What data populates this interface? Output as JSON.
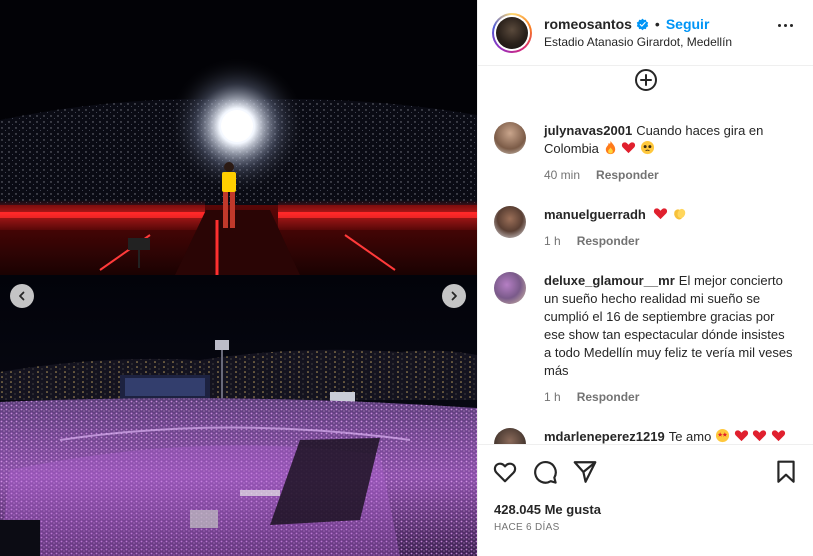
{
  "header": {
    "username": "romeosantos",
    "follow_label": "Seguir",
    "location": "Estadio Atanasio Girardot, Medellín",
    "separator": "•"
  },
  "comments": [
    {
      "user": "julynavas2001",
      "text": "Cuando haces gira en Colombia",
      "emojis": [
        "fire",
        "red-heart",
        "pleading-face"
      ],
      "time": "40 min",
      "reply_label": "Responder"
    },
    {
      "user": "manuelguerradh",
      "text": "",
      "emojis": [
        "red-heart",
        "clapping-hands"
      ],
      "time": "1 h",
      "reply_label": "Responder"
    },
    {
      "user": "deluxe_glamour__mr",
      "text": "El mejor concierto un sueño hecho realidad mi sueño se cumplió el 16 de septiembre gracias por ese show tan espectacular dónde insistes a todo Medellín muy feliz te vería mil veses más",
      "emojis": [],
      "time": "1 h",
      "reply_label": "Responder"
    },
    {
      "user": "mdarleneperez1219",
      "text": "Te amo",
      "emojis": [
        "star-struck",
        "red-heart",
        "red-heart",
        "red-heart"
      ],
      "time": "",
      "reply_label": ""
    }
  ],
  "footer": {
    "likes": "428.045 Me gusta",
    "date": "HACE 6 DÍAS"
  },
  "icons": {
    "load_more": "plus-circle-icon",
    "like": "heart-outline-icon",
    "comment": "speech-bubble-icon",
    "share": "paper-plane-icon",
    "save": "bookmark-icon",
    "prev": "chevron-left-icon",
    "next": "chevron-right-icon",
    "verified": "verified-badge-icon",
    "more": "more-options-icon"
  },
  "colors": {
    "accent": "#0095f6",
    "text": "#262626",
    "muted": "#737373",
    "heart": "#ed4956",
    "stage_red": "#e0161e"
  }
}
